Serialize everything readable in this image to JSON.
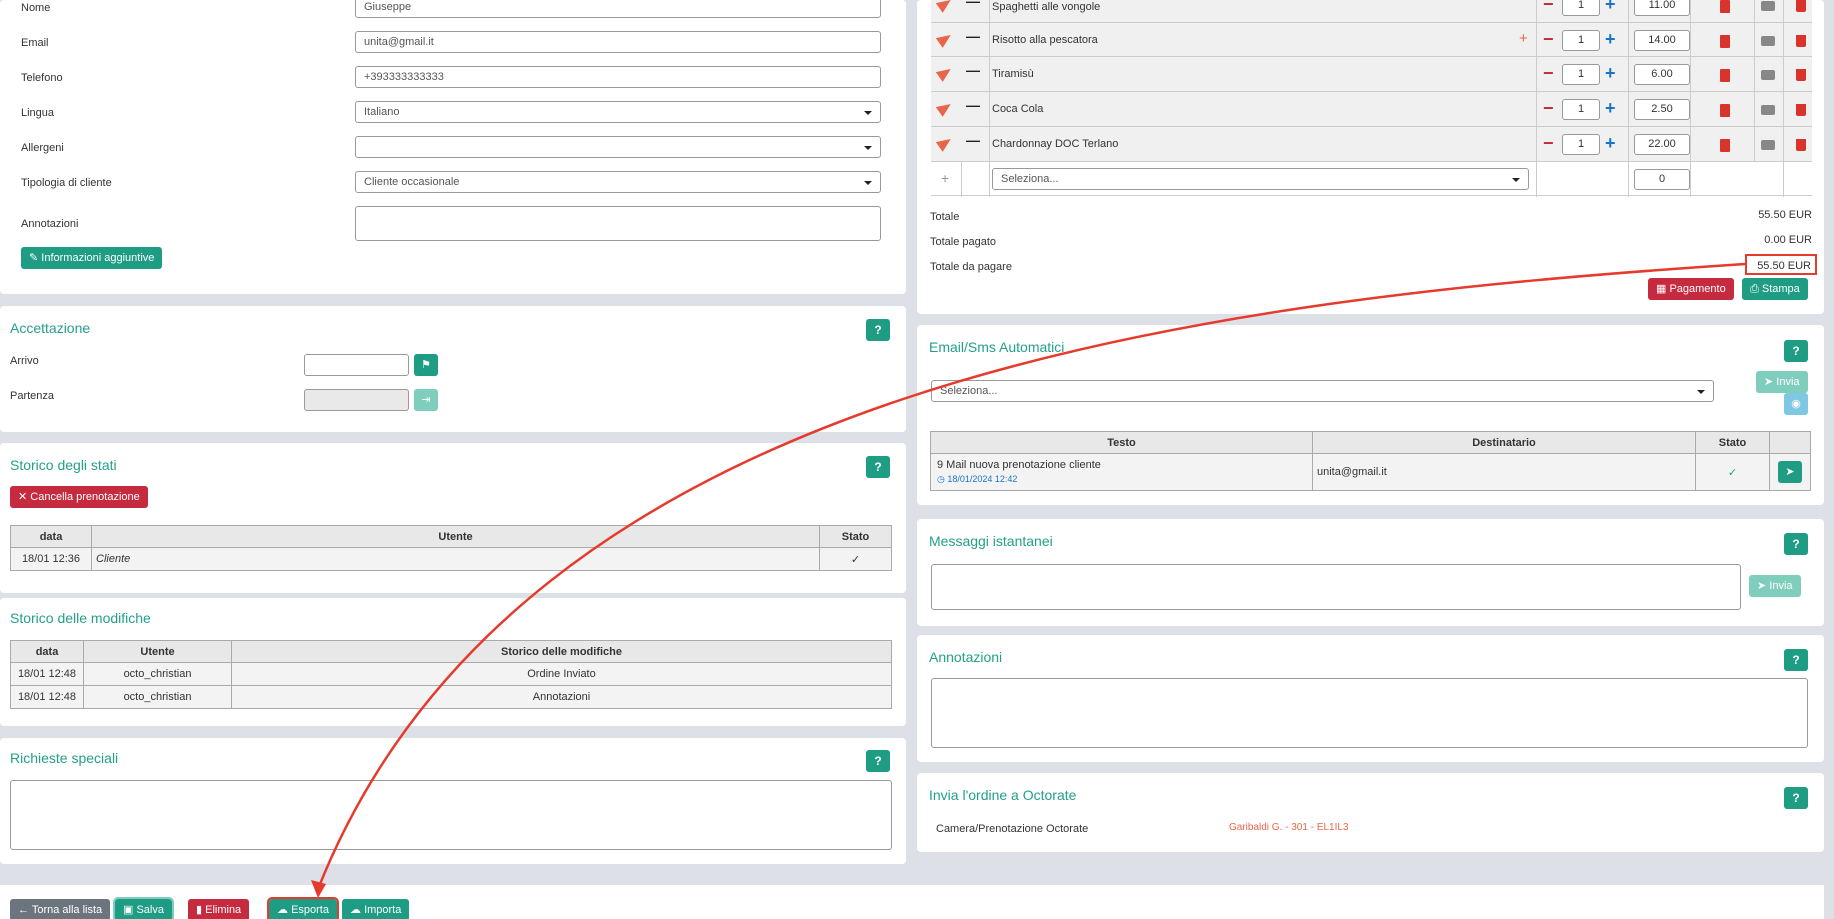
{
  "guest": {
    "name_label": "Nome",
    "name_value": "Giuseppe",
    "email_label": "Email",
    "email_value": "unita@gmail.it",
    "phone_label": "Telefono",
    "phone_value": "+393333333333",
    "lang_label": "Lingua",
    "lang_value": "Italiano",
    "allergens_label": "Allergeni",
    "allergens_value": "",
    "type_label": "Tipologia di cliente",
    "type_value": "Cliente occasionale",
    "notes_label": "Annotazioni",
    "more_info_button": "Informazioni aggiuntive"
  },
  "checkin": {
    "title": "Accettazione",
    "arrival_label": "Arrivo",
    "departure_label": "Partenza",
    "help": "?"
  },
  "status_history": {
    "title": "Storico degli stati",
    "cancel_button": "Cancella prenotazione",
    "help": "?",
    "headers": [
      "data",
      "Utente",
      "Stato"
    ],
    "rows": [
      {
        "date": "18/01 12:36",
        "user": "Cliente",
        "status": "✓"
      }
    ]
  },
  "changes_history": {
    "title": "Storico delle modifiche",
    "headers": [
      "data",
      "Utente",
      "Storico delle modifiche"
    ],
    "rows": [
      {
        "date": "18/01 12:48",
        "user": "octo_christian",
        "change": "Ordine Inviato"
      },
      {
        "date": "18/01 12:48",
        "user": "octo_christian",
        "change": "Annotazioni"
      }
    ]
  },
  "special_requests": {
    "title": "Richieste speciali",
    "help": "?"
  },
  "order": {
    "items": [
      {
        "name": "Spaghetti alle vongole",
        "qty": "1",
        "price": "11.00"
      },
      {
        "name": "Risotto alla pescatora",
        "qty": "1",
        "price": "14.00",
        "extra": "+"
      },
      {
        "name": "Tiramisù",
        "qty": "1",
        "price": "6.00"
      },
      {
        "name": "Coca Cola",
        "qty": "1",
        "price": "2.50"
      },
      {
        "name": "Chardonnay DOC Terlano",
        "qty": "1",
        "price": "22.00"
      }
    ],
    "add_symbol": "+",
    "select_placeholder": "Seleziona...",
    "new_price": "0",
    "totale_label": "Totale",
    "totale_value": "55.50 EUR",
    "pagato_label": "Totale pagato",
    "pagato_value": "0.00 EUR",
    "dapagare_label": "Totale da pagare",
    "dapagare_value": "55.50 EUR",
    "pay_button": "Pagamento",
    "print_button": "Stampa"
  },
  "auto_msgs": {
    "title": "Email/Sms Automatici",
    "help": "?",
    "select_placeholder": "Seleziona...",
    "send_button": "Invia",
    "headers": [
      "Testo",
      "Destinatario",
      "Stato"
    ],
    "row": {
      "text": "9 Mail nuova prenotazione cliente",
      "time": "18/01/2024 12:42",
      "recipient": "unita@gmail.it",
      "status": "✓"
    }
  },
  "instant": {
    "title": "Messaggi istantanei",
    "help": "?",
    "send_button": "Invia"
  },
  "notes": {
    "title": "Annotazioni",
    "help": "?"
  },
  "octorate": {
    "title": "Invia l'ordine a Octorate",
    "help": "?",
    "label": "Camera/Prenotazione Octorate",
    "value": "Garibaldi G. - 301 - EL1IL3"
  },
  "footer": {
    "back": "Torna alla lista",
    "save": "Salva",
    "delete": "Elimina",
    "export": "Esporta",
    "import": "Importa"
  },
  "colors": {
    "accent": "#1e9c84",
    "danger": "#c62a3f",
    "title": "#24a08a",
    "annotation": "#e53a2c"
  }
}
